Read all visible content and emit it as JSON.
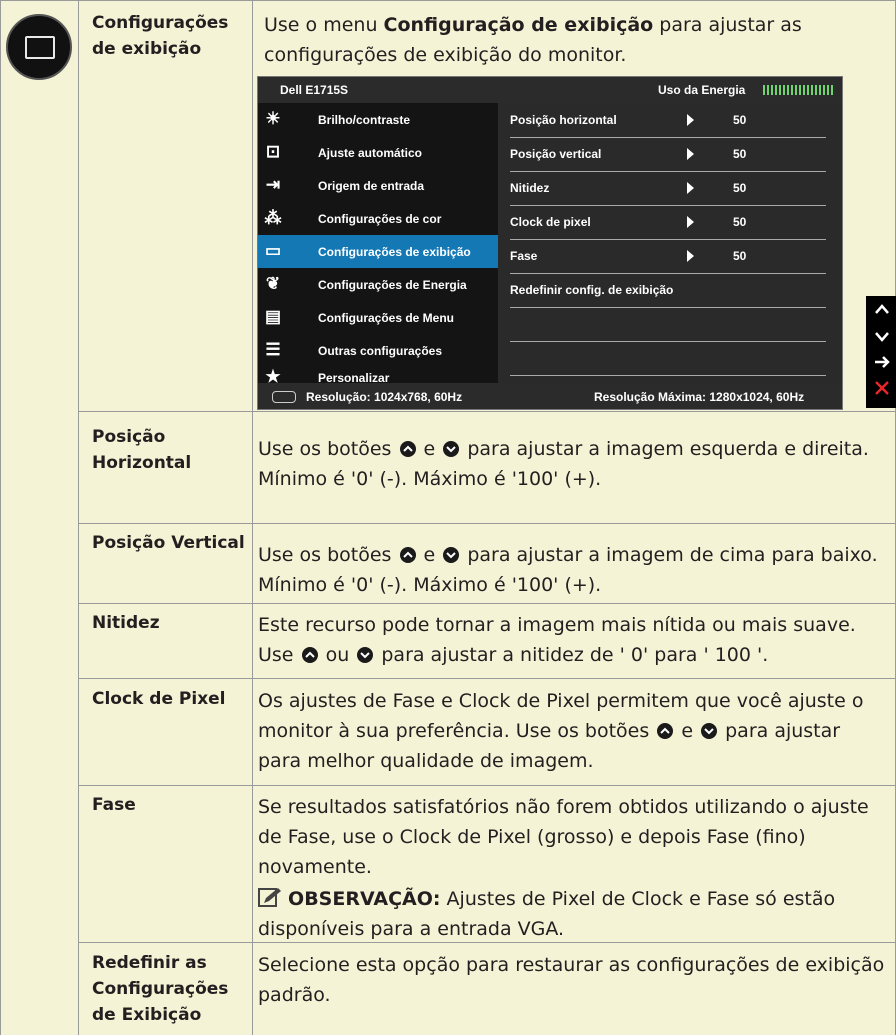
{
  "rows": [
    {
      "label": "Configurações de exibição"
    },
    {
      "label": "Posição Horizontal",
      "text": [
        "Use os botões",
        "e",
        "para ajustar a imagem esquerda e direita. Mínimo é '0' (-). Máximo é '100' (+)."
      ]
    },
    {
      "label": "Posição Vertical",
      "text": [
        "Use os botões",
        "e",
        "para ajustar a imagem de cima para baixo. Mínimo é '0' (-). Máximo é '100' (+)."
      ]
    },
    {
      "label": "Nitidez",
      "text": [
        "Este recurso pode tornar a imagem mais nítida ou mais suave. Use",
        "ou",
        "para ajustar a nitidez de ' 0' para ' 100 '."
      ]
    },
    {
      "label": "Clock de Pixel",
      "text": [
        "Os ajustes de Fase e Clock de Pixel permitem que você ajuste o monitor à sua preferência. Use os botões",
        "e",
        "para ajustar para melhor qualidade de imagem."
      ]
    },
    {
      "label": "Fase",
      "text": "Se resultados satisfatórios não forem obtidos utilizando o ajuste de Fase, use o Clock de Pixel (grosso) e depois Fase (fino) novamente.",
      "note_label": "OBSERVAÇÃO:",
      "note_text": "Ajustes de Pixel de Clock e Fase só estão disponíveis para a entrada VGA."
    },
    {
      "label": "Redefinir as Configurações de Exibição",
      "text": "Selecione esta opção para restaurar as configurações de exibição padrão."
    }
  ],
  "intro": {
    "pre": "Use o menu",
    "bold": "Configuração de exibição",
    "post": "para ajustar as configurações de exibição do monitor."
  },
  "osd": {
    "model": "Dell E1715S",
    "energy_label": "Uso da Energia",
    "menu": [
      {
        "icon": "brightness-icon",
        "glyph": "☀",
        "label": "Brilho/contraste"
      },
      {
        "icon": "auto-adjust-icon",
        "glyph": "⊡",
        "label": "Ajuste automático"
      },
      {
        "icon": "input-source-icon",
        "glyph": "⇥",
        "label": "Origem de entrada"
      },
      {
        "icon": "color-settings-icon",
        "glyph": "⁂",
        "label": "Configurações de cor"
      },
      {
        "icon": "display-settings-icon",
        "glyph": "▭",
        "label": "Configurações de exibição",
        "selected": true
      },
      {
        "icon": "energy-icon",
        "glyph": "❦",
        "label": "Configurações de Energia"
      },
      {
        "icon": "menu-settings-icon",
        "glyph": "▤",
        "label": "Configurações de Menu"
      },
      {
        "icon": "other-settings-icon",
        "glyph": "☰",
        "label": "Outras configurações"
      },
      {
        "icon": "star-icon",
        "glyph": "★",
        "label": "Personalizar"
      }
    ],
    "submenu": [
      {
        "label": "Posição horizontal",
        "value": "50"
      },
      {
        "label": "Posição vertical",
        "value": "50"
      },
      {
        "label": "Nitidez",
        "value": "50"
      },
      {
        "label": "Clock de pixel",
        "value": "50"
      },
      {
        "label": "Fase",
        "value": "50"
      },
      {
        "label": "Redefinir config. de exibição"
      }
    ],
    "resolution": "Resolução: 1024x768, 60Hz",
    "max_resolution": "Resolução Máxima: 1280x1024, 60Hz"
  },
  "nav_buttons": [
    "up-arrow-icon",
    "down-arrow-icon",
    "right-arrow-icon",
    "close-icon"
  ]
}
